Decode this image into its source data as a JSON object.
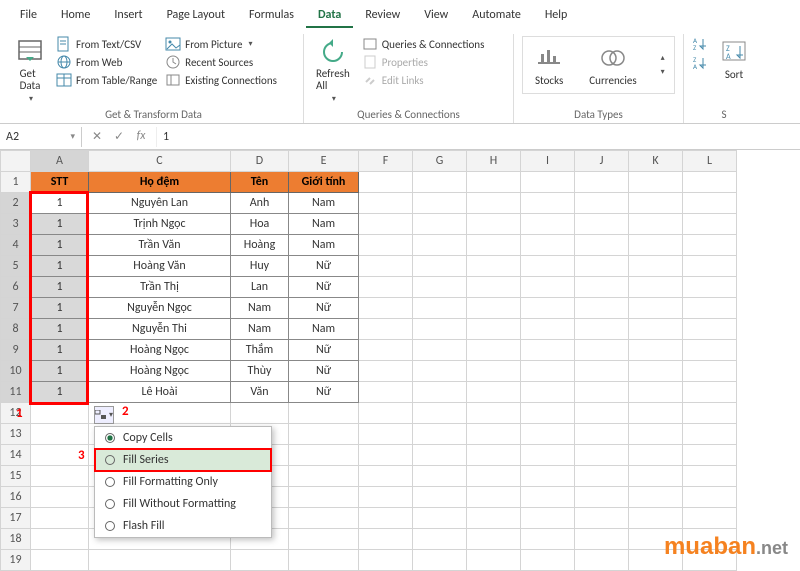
{
  "menu": [
    "File",
    "Home",
    "Insert",
    "Page Layout",
    "Formulas",
    "Data",
    "Review",
    "View",
    "Automate",
    "Help"
  ],
  "menu_active_index": 5,
  "ribbon": {
    "get_transform": {
      "big": "Get\nData",
      "items": [
        "From Text/CSV",
        "From Web",
        "From Table/Range",
        "From Picture",
        "Recent Sources",
        "Existing Connections"
      ],
      "label": "Get & Transform Data"
    },
    "queries": {
      "big": "Refresh\nAll",
      "items": [
        "Queries & Connections",
        "Properties",
        "Edit Links"
      ],
      "label": "Queries & Connections"
    },
    "data_types": {
      "items": [
        "Stocks",
        "Currencies"
      ],
      "label": "Data Types"
    },
    "sort": {
      "big": "Sort",
      "label": "S"
    }
  },
  "namebox": "A2",
  "formula": "1",
  "cols": [
    "A",
    "C",
    "D",
    "E",
    "F",
    "G",
    "H",
    "I",
    "J",
    "K",
    "L"
  ],
  "header_row": [
    "STT",
    "Họ đệm",
    "Tên",
    "Giới tính"
  ],
  "rows": [
    {
      "n": "2",
      "stt": "1",
      "ho": "Nguyên Lan",
      "ten": "Anh",
      "gt": "Nam"
    },
    {
      "n": "3",
      "stt": "1",
      "ho": "Trịnh Ngọc",
      "ten": "Hoa",
      "gt": "Nam"
    },
    {
      "n": "4",
      "stt": "1",
      "ho": "Trần Văn",
      "ten": "Hoàng",
      "gt": "Nam"
    },
    {
      "n": "5",
      "stt": "1",
      "ho": "Hoàng Văn",
      "ten": "Huy",
      "gt": "Nữ"
    },
    {
      "n": "6",
      "stt": "1",
      "ho": "Trần Thị",
      "ten": "Lan",
      "gt": "Nữ"
    },
    {
      "n": "7",
      "stt": "1",
      "ho": "Nguyễn Ngọc",
      "ten": "Nam",
      "gt": "Nữ"
    },
    {
      "n": "8",
      "stt": "1",
      "ho": "Nguyễn Thi",
      "ten": "Nam",
      "gt": "Nam"
    },
    {
      "n": "9",
      "stt": "1",
      "ho": "Hoàng Ngọc",
      "ten": "Thắm",
      "gt": "Nữ"
    },
    {
      "n": "10",
      "stt": "1",
      "ho": "Hoàng Ngọc",
      "ten": "Thùy",
      "gt": "Nữ"
    },
    {
      "n": "11",
      "stt": "1",
      "ho": "Lê Hoài",
      "ten": "Văn",
      "gt": "Nữ"
    }
  ],
  "empty_rows": [
    "12",
    "13",
    "14",
    "15",
    "16",
    "17",
    "18",
    "19"
  ],
  "ctx_menu": [
    "Copy Cells",
    "Fill Series",
    "Fill Formatting Only",
    "Fill Without Formatting",
    "Flash Fill"
  ],
  "ctx_selected": 0,
  "ctx_hover": 1,
  "annotations": {
    "a1": "1",
    "a2": "2",
    "a3": "3"
  },
  "watermark": {
    "brand": "muaban",
    "suffix": ".net"
  }
}
